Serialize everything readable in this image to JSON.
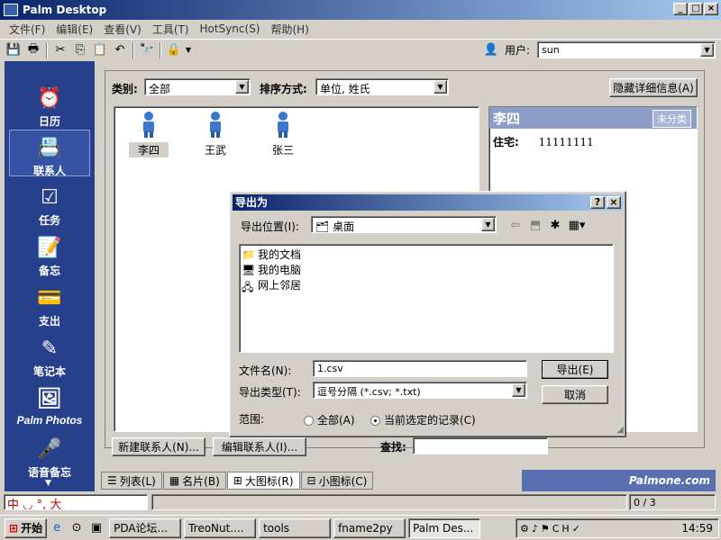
{
  "window": {
    "title": "Palm Desktop"
  },
  "menu": [
    "文件(F)",
    "编辑(E)",
    "查看(V)",
    "工具(T)",
    "HotSync(S)",
    "帮助(H)"
  ],
  "toolbar": {
    "user_label": "用户:",
    "user_value": "sun"
  },
  "sidebar": [
    {
      "label": "日历",
      "icon": "calendar-icon"
    },
    {
      "label": "联系人",
      "icon": "contacts-icon"
    },
    {
      "label": "任务",
      "icon": "tasks-icon"
    },
    {
      "label": "备忘",
      "icon": "memo-icon"
    },
    {
      "label": "支出",
      "icon": "expense-icon"
    },
    {
      "label": "笔记本",
      "icon": "notepad-icon"
    },
    {
      "label": "Palm Photos",
      "icon": "photos-icon"
    },
    {
      "label": "语音备忘",
      "icon": "voice-memo-icon"
    }
  ],
  "main": {
    "category_label": "类别:",
    "category_value": "全部",
    "sort_label": "排序方式:",
    "sort_value": "单位, 姓氏",
    "hide_details_button": "隐藏详细信息(A)",
    "contacts": [
      "李四",
      "王武",
      "张三"
    ],
    "detail": {
      "name": "李四",
      "category": "未分类",
      "field_label": "住宅:",
      "field_value": "11111111"
    },
    "new_contact_button": "新建联系人(N)...",
    "edit_contact_button": "编辑联系人(I)...",
    "find_label": "查找:",
    "find_value": ""
  },
  "tabs": [
    "列表(L)",
    "名片(B)",
    "大图标(R)",
    "小图标(C)"
  ],
  "brand": "Palmone.com",
  "status": {
    "ime_text": "中 ◡ °, 大",
    "count": "0 / 3"
  },
  "dialog": {
    "title": "导出为",
    "location_label": "导出位置(I):",
    "location_value": "桌面",
    "files": [
      "我的文档",
      "我的电脑",
      "网上邻居"
    ],
    "filename_label": "文件名(N):",
    "filename_value": "1.csv",
    "filetype_label": "导出类型(T):",
    "filetype_value": "逗号分隔 (*.csv; *.txt)",
    "range_label": "范围:",
    "range_all": "全部(A)",
    "range_selected": "当前选定的记录(C)",
    "export_button": "导出(E)",
    "cancel_button": "取消"
  },
  "taskbar": {
    "start": "开始",
    "items": [
      "PDA论坛...",
      "TreoNut....",
      "tools",
      "fname2py",
      "Palm Des..."
    ],
    "clock": "14:59"
  }
}
